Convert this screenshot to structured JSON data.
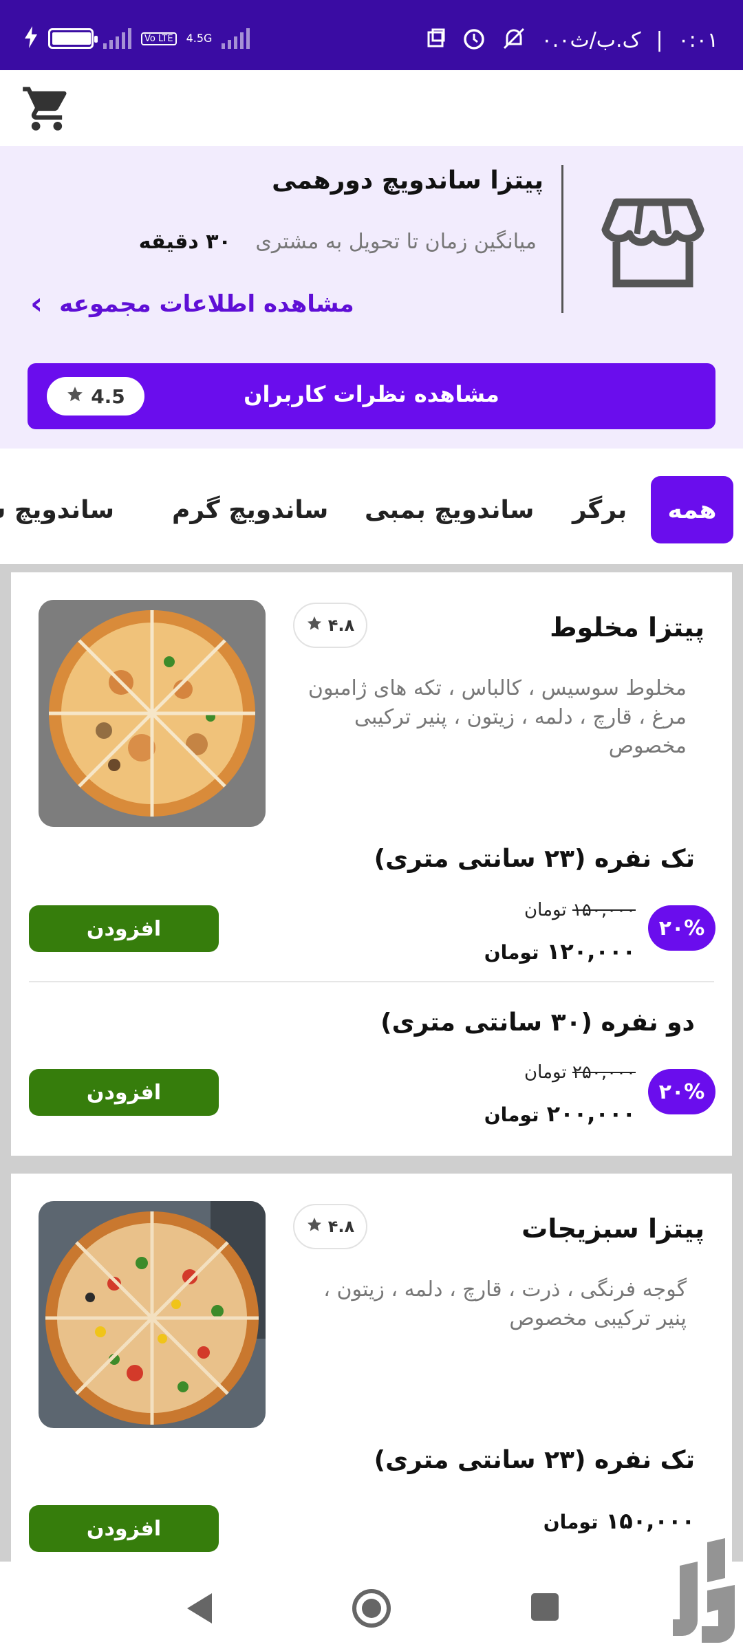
{
  "status_bar": {
    "time": "۰:۰۱",
    "left_extra": "۰.۰ک.ب/ث",
    "network": "4.5G",
    "volte": "Vo LTE",
    "battery_level": 0.85,
    "icons": [
      "charging-icon",
      "battery-icon",
      "signal-icon",
      "volte-icon",
      "alarm-icon",
      "mute-icon",
      "notification-icon"
    ]
  },
  "topbar": {
    "cart_icon": "cart-icon"
  },
  "shop": {
    "name": "پیتزا ساندویچ دورهمی",
    "delivery_label": "میانگین زمان تا تحویل به مشتری",
    "delivery_value": "۳۰ دقیقه",
    "info_link": "مشاهده اطلاعات مجموعه",
    "reviews_button": "مشاهده نظرات کاربران",
    "rating": "4.5"
  },
  "tabs": [
    {
      "label": "همه",
      "active": true
    },
    {
      "label": "برگر",
      "active": false
    },
    {
      "label": "ساندویچ بمبی",
      "active": false
    },
    {
      "label": "ساندویچ گرم",
      "active": false
    },
    {
      "label": "ساندویچ سرد",
      "active": false
    }
  ],
  "products": [
    {
      "name": "پیتزا مخلوط",
      "rating": "۴.۸",
      "description": "مخلوط سوسیس ، کالباس ، تکه های ژامبون مرغ ، قارچ ، دلمه ، زیتون ، پنیر ترکیبی مخصوص",
      "sizes": [
        {
          "title": "تک نفره (۲۳ سانتی متری)",
          "discount": "۲۰%",
          "old_price": "۱۵۰,۰۰۰",
          "price": "۱۲۰,۰۰۰",
          "currency": "تومان",
          "add_label": "افزودن"
        },
        {
          "title": "دو نفره (۳۰ سانتی متری)",
          "discount": "۲۰%",
          "old_price": "۲۵۰,۰۰۰",
          "price": "۲۰۰,۰۰۰",
          "currency": "تومان",
          "add_label": "افزودن"
        }
      ]
    },
    {
      "name": "پیتزا سبزیجات",
      "rating": "۴.۸",
      "description": "گوجه فرنگی ، ذرت ، قارچ ، دلمه ، زیتون ، پنیر ترکیبی مخصوص",
      "sizes": [
        {
          "title": "تک نفره (۲۳ سانتی متری)",
          "price": "۱۵۰,۰۰۰",
          "currency": "تومان",
          "add_label": "افزودن"
        }
      ]
    }
  ],
  "colors": {
    "status_bar": "#3a0ca3",
    "accent": "#6a0ded",
    "add_button": "#367d0c",
    "shop_bg": "#f2ecfd"
  }
}
